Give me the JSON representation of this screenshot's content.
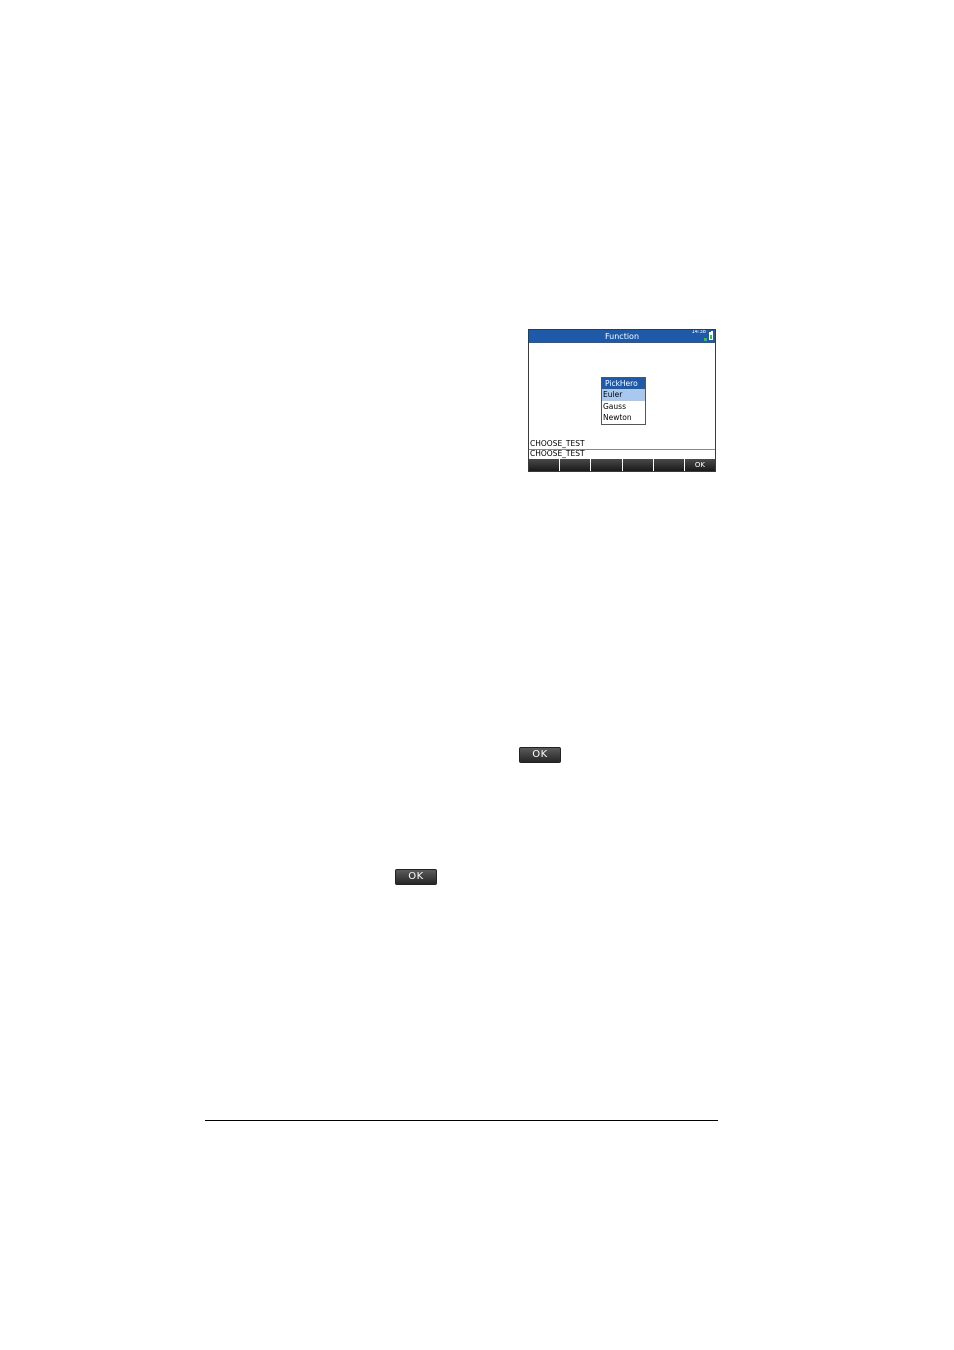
{
  "screen": {
    "title": "Function",
    "clock": "14:38",
    "dialog": {
      "title": "PickHero",
      "items": [
        "Euler",
        "Gauss",
        "Newton"
      ],
      "selected_index": 0
    },
    "history_line": "CHOOSE_TEST",
    "entry_line": "CHOOSE_TEST",
    "softkeys": [
      "",
      "",
      "",
      "",
      "",
      "OK"
    ]
  },
  "inline_keys": {
    "ok_1": "OK",
    "ok_2": "OK"
  },
  "colors": {
    "title_bar": "#1f5aa8",
    "selection": "#a8c8f0",
    "battery": "#33c23a"
  }
}
